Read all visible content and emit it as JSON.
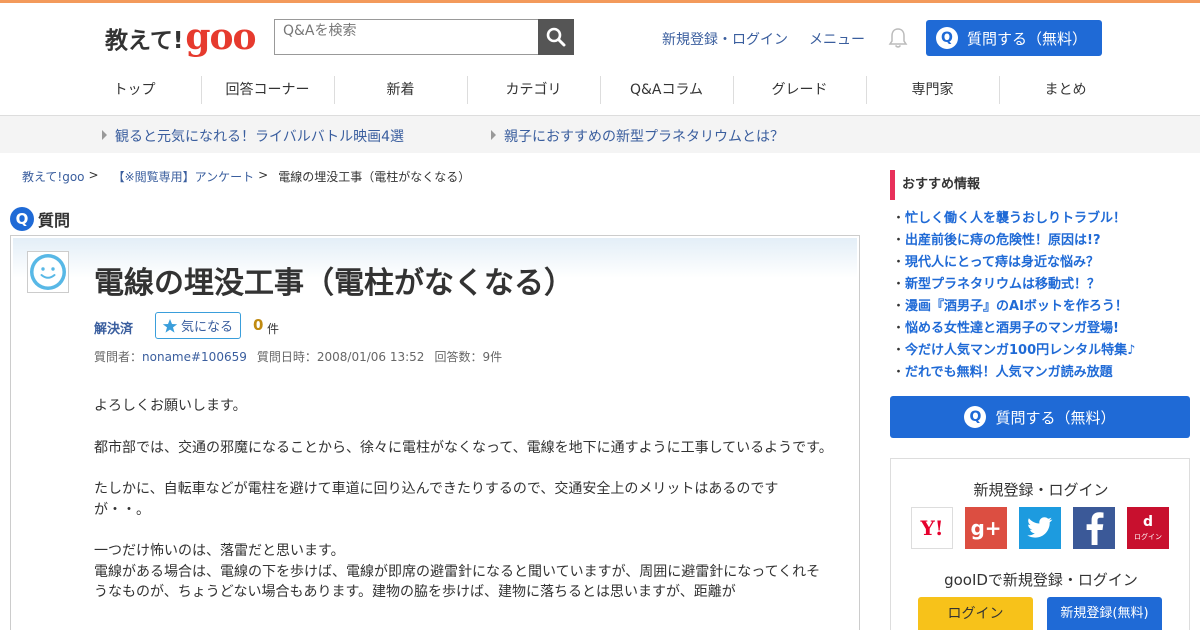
{
  "header": {
    "logo_text": "教えて!",
    "logo_goo": "goo",
    "search_placeholder": "Q&Aを検索",
    "register_login": "新規登録・ログイン",
    "menu": "メニュー",
    "ask_button": "質問する（無料）",
    "ask_q": "Q"
  },
  "nav": {
    "items": [
      "トップ",
      "回答コーナー",
      "新着",
      "カテゴリ",
      "Q&Aコラム",
      "グレード",
      "専門家",
      "まとめ"
    ]
  },
  "promo": {
    "links": [
      "観ると元気になれる！ライバルバトル映画4選",
      "親子におすすめの新型プラネタリウムとは？"
    ]
  },
  "breadcrumb": {
    "items": [
      "教えて!goo",
      "【※閲覧専用】アンケート",
      "電線の埋没工事（電柱がなくなる）"
    ],
    "sep": ">"
  },
  "question": {
    "label_q": "Q",
    "label": "質問",
    "title": "電線の埋没工事（電柱がなくなる）",
    "status": "解決済",
    "fav_label": "気になる",
    "fav_count": "0",
    "fav_unit": "件",
    "meta": {
      "asker_label": "質問者：",
      "asker": "noname#100659",
      "date_label": "質問日時：",
      "date": "2008/01/06 13:52",
      "answers_label": "回答数：",
      "answers": "9件"
    },
    "body": [
      "よろしくお願いします。",
      "都市部では、交通の邪魔になることから、徐々に電柱がなくなって、電線を地下に通すように工事しているようです。",
      "たしかに、自転車などが電柱を避けて車道に回り込んできたりするので、交通安全上のメリットはあるのですが・・。",
      "一つだけ怖いのは、落雷だと思います。\n電線がある場合は、電線の下を歩けば、電線が即席の避雷針になると聞いていますが、周囲に避雷針になってくれそうなものが、ちょうどない場合もあります。建物の脇を歩けば、建物に落ちるとは思いますが、距離が"
    ]
  },
  "sidebar": {
    "rec_title": "おすすめ情報",
    "rec_items": [
      "忙しく働く人を襲うおしりトラブル！",
      "出産前後に痔の危険性！原因は!?",
      "現代人にとって痔は身近な悩み？",
      "新型プラネタリウムは移動式！？",
      "漫画『酒男子』のAIボットを作ろう！",
      "悩める女性達と酒男子のマンガ登場!",
      "今だけ人気マンガ100円レンタル特集♪",
      "だれでも無料！人気マンガ読み放題"
    ],
    "ask_button": "質問する（無料）",
    "ask_q": "Q",
    "login_title": "新規登録・ログイン",
    "sns": {
      "yahoo": "Y!",
      "google": "g+",
      "docomo_d": "d",
      "docomo_login": "ログイン"
    },
    "gooid_title": "gooIDで新規登録・ログイン",
    "login_button": "ログイン",
    "register_button": "新規登録(無料)"
  }
}
